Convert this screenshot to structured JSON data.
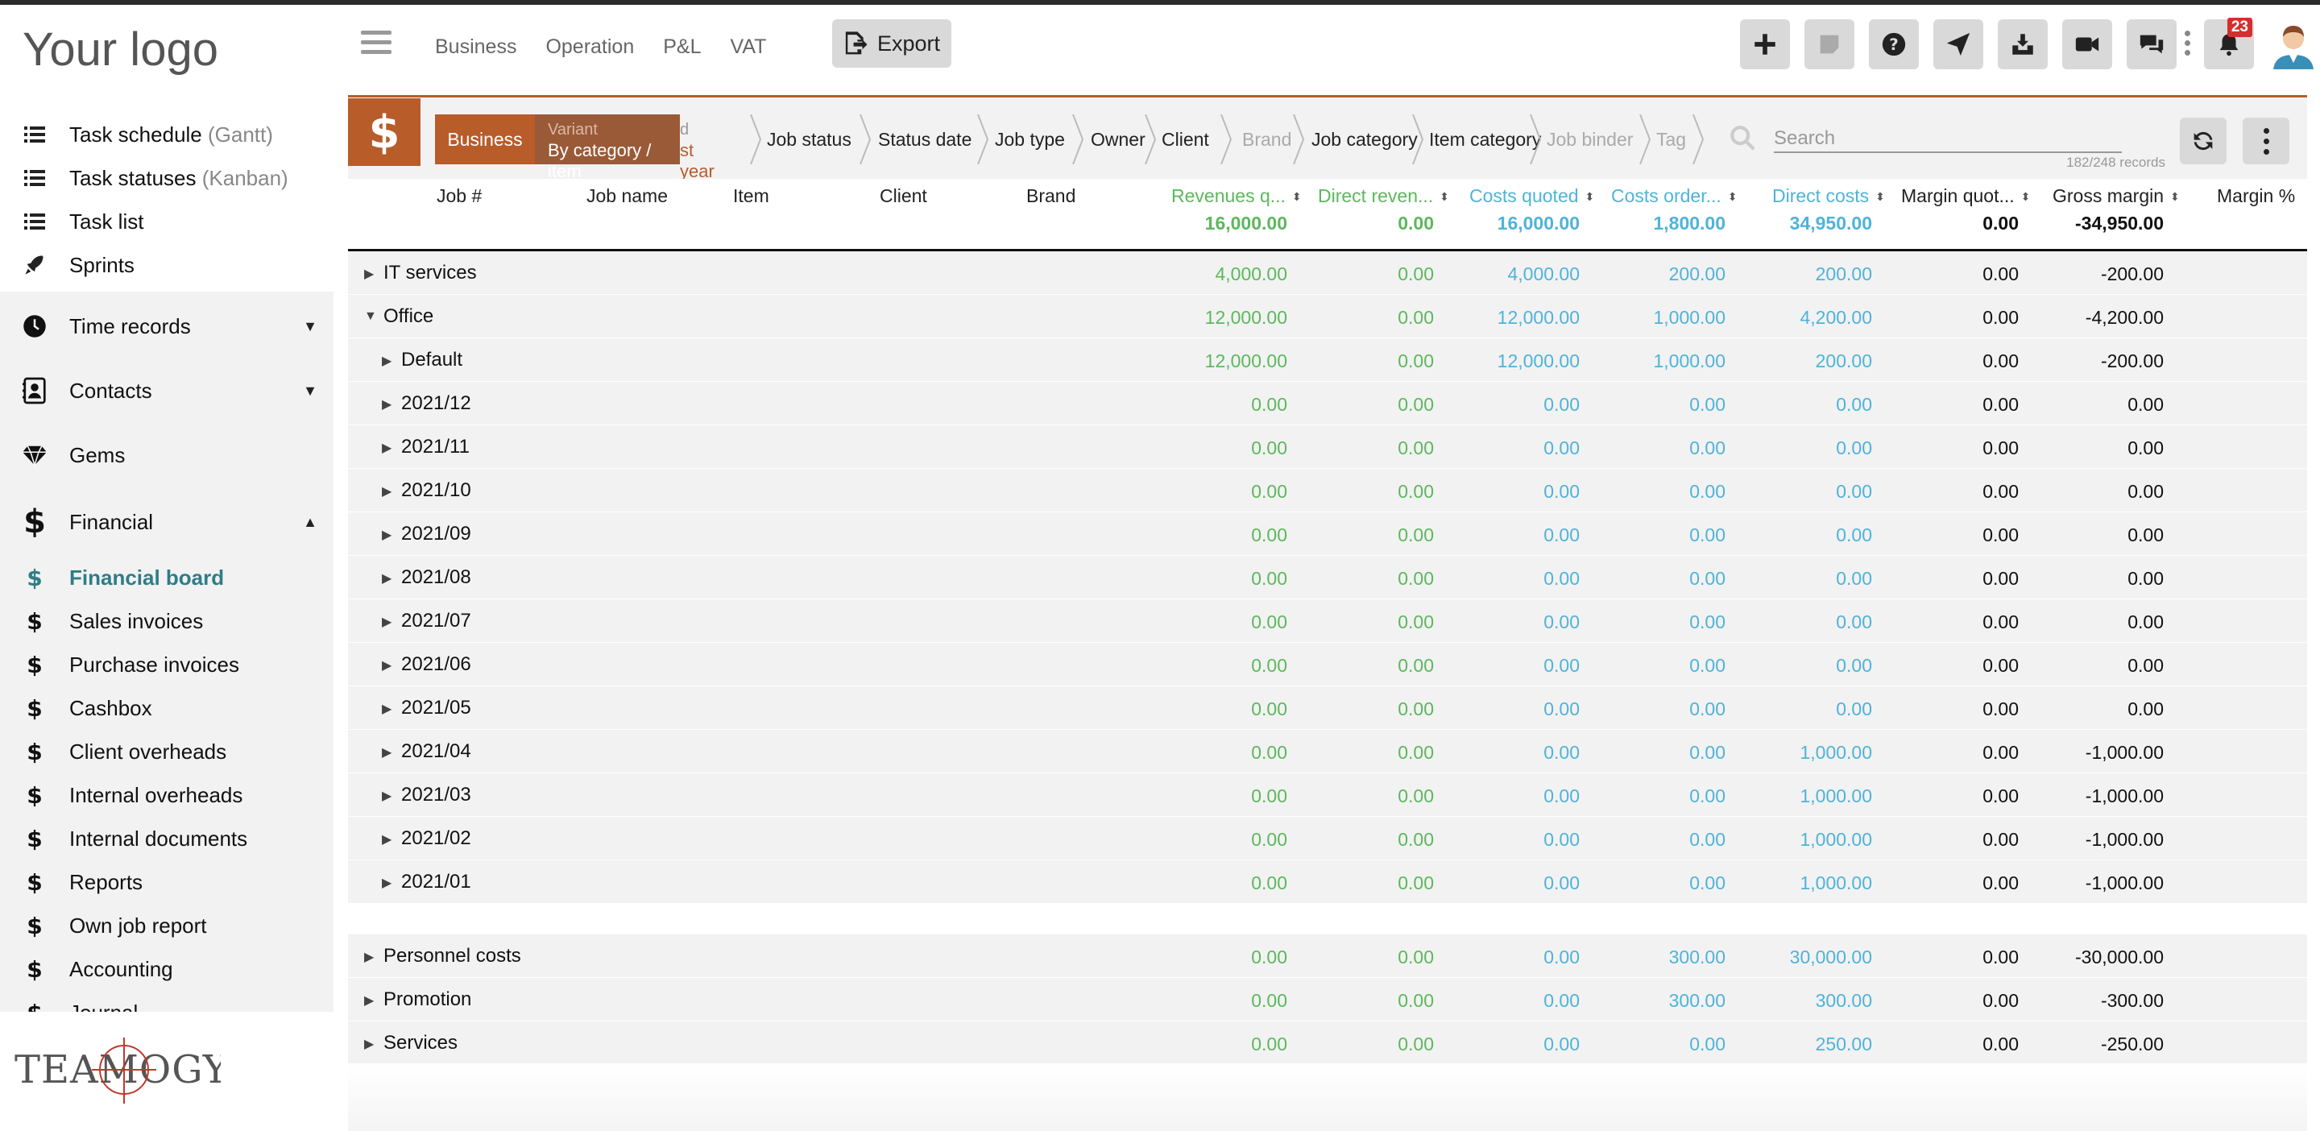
{
  "app": {
    "logo_text": "Your logo",
    "brand_logo": "TEAMOGY",
    "accent_color": "#b85c2a",
    "active_color": "#2e7d87"
  },
  "topnav": [
    "Business",
    "Operation",
    "P&L",
    "VAT"
  ],
  "toolbar": {
    "export_label": "Export",
    "icons": [
      "plus-icon",
      "note-icon",
      "help-icon",
      "send-icon",
      "inbox-icon",
      "video-icon",
      "chat-icon",
      "bell-icon"
    ],
    "notification_count": "23"
  },
  "sidebar": {
    "items": [
      {
        "name": "task-schedule",
        "label": "Task schedule",
        "sub": "(Gantt)",
        "icon": "list-icon"
      },
      {
        "name": "task-statuses",
        "label": "Task statuses",
        "sub": "(Kanban)",
        "icon": "list-icon"
      },
      {
        "name": "task-list",
        "label": "Task list",
        "sub": "",
        "icon": "list-icon"
      },
      {
        "name": "sprints",
        "label": "Sprints",
        "sub": "",
        "icon": "rocket-icon"
      },
      {
        "name": "time-records",
        "label": "Time records",
        "icon": "clock-icon"
      },
      {
        "name": "contacts",
        "label": "Contacts",
        "icon": "contacts-icon"
      },
      {
        "name": "gems",
        "label": "Gems",
        "icon": "gem-icon"
      },
      {
        "name": "financial",
        "label": "Financial",
        "icon": "dollar-icon"
      }
    ],
    "financial_items": [
      "Financial board",
      "Sales invoices",
      "Purchase invoices",
      "Cashbox",
      "Client overheads",
      "Internal overheads",
      "Internal documents",
      "Reports",
      "Own job report",
      "Accounting",
      "Journal"
    ]
  },
  "breadcrumb": {
    "business": "Business",
    "variant_label": "Variant",
    "variant_value": "By category / item",
    "variant_tail_top": "d",
    "variant_tail_bottom": "st year",
    "filters": [
      "Job status",
      "Status date",
      "Job type",
      "Owner",
      "Client",
      "Brand",
      "Job category",
      "Item category",
      "Job binder",
      "Tag"
    ]
  },
  "search": {
    "placeholder": "Search",
    "records": "182/248 records"
  },
  "table": {
    "columns": [
      "Job #",
      "Job name",
      "Item",
      "Client",
      "Brand",
      "Revenues q...",
      "Direct reven...",
      "Costs quoted",
      "Costs order...",
      "Direct costs",
      "Margin quot...",
      "Gross margin",
      "Margin %"
    ],
    "totals": [
      "16,000.00",
      "0.00",
      "16,000.00",
      "1,800.00",
      "34,950.00",
      "0.00",
      "-34,950.00"
    ],
    "rows": [
      {
        "name": "IT services",
        "level": 0,
        "expanded": false,
        "v": [
          "4,000.00",
          "0.00",
          "4,000.00",
          "200.00",
          "200.00",
          "0.00",
          "-200.00"
        ]
      },
      {
        "name": "Office",
        "level": 0,
        "expanded": true,
        "v": [
          "12,000.00",
          "0.00",
          "12,000.00",
          "1,000.00",
          "4,200.00",
          "0.00",
          "-4,200.00"
        ]
      },
      {
        "name": "Default",
        "level": 1,
        "expanded": false,
        "v": [
          "12,000.00",
          "0.00",
          "12,000.00",
          "1,000.00",
          "200.00",
          "0.00",
          "-200.00"
        ]
      },
      {
        "name": "2021/12",
        "level": 1,
        "expanded": false,
        "v": [
          "0.00",
          "0.00",
          "0.00",
          "0.00",
          "0.00",
          "0.00",
          "0.00"
        ]
      },
      {
        "name": "2021/11",
        "level": 1,
        "expanded": false,
        "v": [
          "0.00",
          "0.00",
          "0.00",
          "0.00",
          "0.00",
          "0.00",
          "0.00"
        ]
      },
      {
        "name": "2021/10",
        "level": 1,
        "expanded": false,
        "v": [
          "0.00",
          "0.00",
          "0.00",
          "0.00",
          "0.00",
          "0.00",
          "0.00"
        ]
      },
      {
        "name": "2021/09",
        "level": 1,
        "expanded": false,
        "v": [
          "0.00",
          "0.00",
          "0.00",
          "0.00",
          "0.00",
          "0.00",
          "0.00"
        ]
      },
      {
        "name": "2021/08",
        "level": 1,
        "expanded": false,
        "v": [
          "0.00",
          "0.00",
          "0.00",
          "0.00",
          "0.00",
          "0.00",
          "0.00"
        ]
      },
      {
        "name": "2021/07",
        "level": 1,
        "expanded": false,
        "v": [
          "0.00",
          "0.00",
          "0.00",
          "0.00",
          "0.00",
          "0.00",
          "0.00"
        ]
      },
      {
        "name": "2021/06",
        "level": 1,
        "expanded": false,
        "v": [
          "0.00",
          "0.00",
          "0.00",
          "0.00",
          "0.00",
          "0.00",
          "0.00"
        ]
      },
      {
        "name": "2021/05",
        "level": 1,
        "expanded": false,
        "v": [
          "0.00",
          "0.00",
          "0.00",
          "0.00",
          "0.00",
          "0.00",
          "0.00"
        ]
      },
      {
        "name": "2021/04",
        "level": 1,
        "expanded": false,
        "v": [
          "0.00",
          "0.00",
          "0.00",
          "0.00",
          "1,000.00",
          "0.00",
          "-1,000.00"
        ]
      },
      {
        "name": "2021/03",
        "level": 1,
        "expanded": false,
        "v": [
          "0.00",
          "0.00",
          "0.00",
          "0.00",
          "1,000.00",
          "0.00",
          "-1,000.00"
        ]
      },
      {
        "name": "2021/02",
        "level": 1,
        "expanded": false,
        "v": [
          "0.00",
          "0.00",
          "0.00",
          "0.00",
          "1,000.00",
          "0.00",
          "-1,000.00"
        ]
      },
      {
        "name": "2021/01",
        "level": 1,
        "expanded": false,
        "v": [
          "0.00",
          "0.00",
          "0.00",
          "0.00",
          "1,000.00",
          "0.00",
          "-1,000.00"
        ]
      }
    ],
    "rows_after_gap": [
      {
        "name": "Personnel costs",
        "level": 0,
        "expanded": false,
        "v": [
          "0.00",
          "0.00",
          "0.00",
          "300.00",
          "30,000.00",
          "0.00",
          "-30,000.00"
        ]
      },
      {
        "name": "Promotion",
        "level": 0,
        "expanded": false,
        "v": [
          "0.00",
          "0.00",
          "0.00",
          "300.00",
          "300.00",
          "0.00",
          "-300.00"
        ]
      },
      {
        "name": "Services",
        "level": 0,
        "expanded": false,
        "v": [
          "0.00",
          "0.00",
          "0.00",
          "0.00",
          "250.00",
          "0.00",
          "-250.00"
        ]
      }
    ]
  }
}
